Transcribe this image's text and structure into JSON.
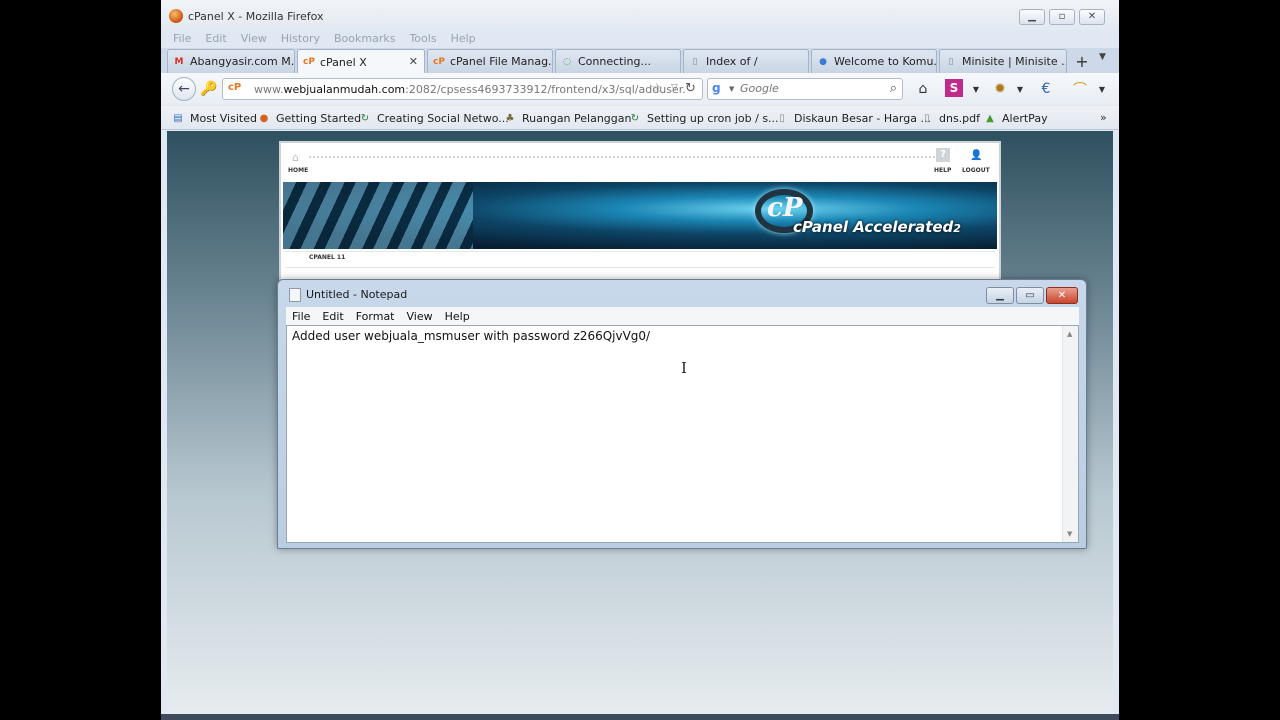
{
  "browser": {
    "title": "cPanel X - Mozilla Firefox",
    "menu": [
      "File",
      "Edit",
      "View",
      "History",
      "Bookmarks",
      "Tools",
      "Help"
    ],
    "tabs": [
      {
        "label": "Abangyasir.com M...",
        "icon": "gmail-icon"
      },
      {
        "label": "cPanel X",
        "icon": "cpanel-icon",
        "active": true
      },
      {
        "label": "cPanel File Manag...",
        "icon": "cpanel-icon"
      },
      {
        "label": "Connecting...",
        "icon": "loading-icon"
      },
      {
        "label": "Index of /",
        "icon": "page-icon"
      },
      {
        "label": "Welcome to Komu...",
        "icon": "globe-icon"
      },
      {
        "label": "Minisite | Minisite ...",
        "icon": "page-icon"
      }
    ],
    "new_tab": "+",
    "url_base": "www.",
    "url_domain": "webjualanmudah.com",
    "url_rest": ":2082/cpsess4693733912/frontend/x3/sql/adduser.",
    "search_placeholder": "Google",
    "bookmarks": [
      {
        "label": "Most Visited",
        "icon": "most-visited-icon"
      },
      {
        "label": "Getting Started",
        "icon": "firefox-icon"
      },
      {
        "label": "Creating Social Netwo...",
        "icon": "refresh-icon"
      },
      {
        "label": "Ruangan Pelanggan",
        "icon": "bookmark-icon"
      },
      {
        "label": "Setting up cron job / s...",
        "icon": "refresh-icon"
      },
      {
        "label": "Diskaun Besar - Harga ...",
        "icon": "page-icon"
      },
      {
        "label": "dns.pdf",
        "icon": "page-icon"
      },
      {
        "label": "AlertPay",
        "icon": "alertpay-icon"
      }
    ],
    "bookmarks_more": "»"
  },
  "cpanel": {
    "home_label": "HOME",
    "help_label": "HELP",
    "logout_label": "LOGOUT",
    "logo_mark": "cP",
    "logo_text": "cPanel Accelerated",
    "logo_sub": "2",
    "version_label": "CPANEL 11"
  },
  "notepad": {
    "title": "Untitled - Notepad",
    "menu": [
      "File",
      "Edit",
      "Format",
      "View",
      "Help"
    ],
    "content": "Added user webjuala_msmuser with password z266QjvVg0/"
  }
}
